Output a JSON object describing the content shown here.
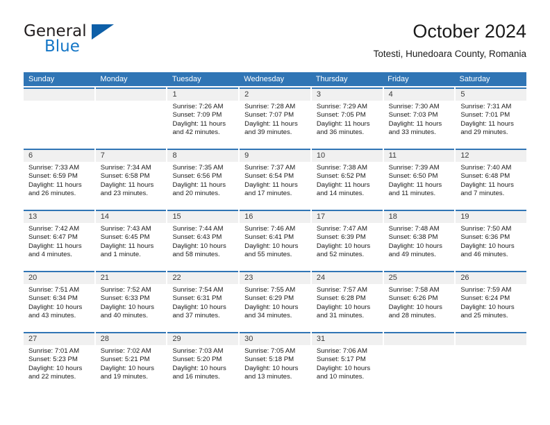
{
  "logo": {
    "word1": "General",
    "word2": "Blue",
    "triangle_color": "#0d5fa8",
    "blue_text_color": "#1476c6"
  },
  "header": {
    "title": "October 2024",
    "subtitle": "Totesti, Hunedoara County, Romania"
  },
  "theme": {
    "header_blue": "#3075b5",
    "date_strip_gray": "#f0f0f0"
  },
  "weekday_headers": [
    "Sunday",
    "Monday",
    "Tuesday",
    "Wednesday",
    "Thursday",
    "Friday",
    "Saturday"
  ],
  "weeks": [
    [
      {
        "day": "",
        "empty": true,
        "sunrise": "",
        "sunset": "",
        "daylight1": "",
        "daylight2": ""
      },
      {
        "day": "",
        "empty": true,
        "sunrise": "",
        "sunset": "",
        "daylight1": "",
        "daylight2": ""
      },
      {
        "day": "1",
        "sunrise": "Sunrise: 7:26 AM",
        "sunset": "Sunset: 7:09 PM",
        "daylight1": "Daylight: 11 hours",
        "daylight2": "and 42 minutes."
      },
      {
        "day": "2",
        "sunrise": "Sunrise: 7:28 AM",
        "sunset": "Sunset: 7:07 PM",
        "daylight1": "Daylight: 11 hours",
        "daylight2": "and 39 minutes."
      },
      {
        "day": "3",
        "sunrise": "Sunrise: 7:29 AM",
        "sunset": "Sunset: 7:05 PM",
        "daylight1": "Daylight: 11 hours",
        "daylight2": "and 36 minutes."
      },
      {
        "day": "4",
        "sunrise": "Sunrise: 7:30 AM",
        "sunset": "Sunset: 7:03 PM",
        "daylight1": "Daylight: 11 hours",
        "daylight2": "and 33 minutes."
      },
      {
        "day": "5",
        "sunrise": "Sunrise: 7:31 AM",
        "sunset": "Sunset: 7:01 PM",
        "daylight1": "Daylight: 11 hours",
        "daylight2": "and 29 minutes."
      }
    ],
    [
      {
        "day": "6",
        "sunrise": "Sunrise: 7:33 AM",
        "sunset": "Sunset: 6:59 PM",
        "daylight1": "Daylight: 11 hours",
        "daylight2": "and 26 minutes."
      },
      {
        "day": "7",
        "sunrise": "Sunrise: 7:34 AM",
        "sunset": "Sunset: 6:58 PM",
        "daylight1": "Daylight: 11 hours",
        "daylight2": "and 23 minutes."
      },
      {
        "day": "8",
        "sunrise": "Sunrise: 7:35 AM",
        "sunset": "Sunset: 6:56 PM",
        "daylight1": "Daylight: 11 hours",
        "daylight2": "and 20 minutes."
      },
      {
        "day": "9",
        "sunrise": "Sunrise: 7:37 AM",
        "sunset": "Sunset: 6:54 PM",
        "daylight1": "Daylight: 11 hours",
        "daylight2": "and 17 minutes."
      },
      {
        "day": "10",
        "sunrise": "Sunrise: 7:38 AM",
        "sunset": "Sunset: 6:52 PM",
        "daylight1": "Daylight: 11 hours",
        "daylight2": "and 14 minutes."
      },
      {
        "day": "11",
        "sunrise": "Sunrise: 7:39 AM",
        "sunset": "Sunset: 6:50 PM",
        "daylight1": "Daylight: 11 hours",
        "daylight2": "and 11 minutes."
      },
      {
        "day": "12",
        "sunrise": "Sunrise: 7:40 AM",
        "sunset": "Sunset: 6:48 PM",
        "daylight1": "Daylight: 11 hours",
        "daylight2": "and 7 minutes."
      }
    ],
    [
      {
        "day": "13",
        "sunrise": "Sunrise: 7:42 AM",
        "sunset": "Sunset: 6:47 PM",
        "daylight1": "Daylight: 11 hours",
        "daylight2": "and 4 minutes."
      },
      {
        "day": "14",
        "sunrise": "Sunrise: 7:43 AM",
        "sunset": "Sunset: 6:45 PM",
        "daylight1": "Daylight: 11 hours",
        "daylight2": "and 1 minute."
      },
      {
        "day": "15",
        "sunrise": "Sunrise: 7:44 AM",
        "sunset": "Sunset: 6:43 PM",
        "daylight1": "Daylight: 10 hours",
        "daylight2": "and 58 minutes."
      },
      {
        "day": "16",
        "sunrise": "Sunrise: 7:46 AM",
        "sunset": "Sunset: 6:41 PM",
        "daylight1": "Daylight: 10 hours",
        "daylight2": "and 55 minutes."
      },
      {
        "day": "17",
        "sunrise": "Sunrise: 7:47 AM",
        "sunset": "Sunset: 6:39 PM",
        "daylight1": "Daylight: 10 hours",
        "daylight2": "and 52 minutes."
      },
      {
        "day": "18",
        "sunrise": "Sunrise: 7:48 AM",
        "sunset": "Sunset: 6:38 PM",
        "daylight1": "Daylight: 10 hours",
        "daylight2": "and 49 minutes."
      },
      {
        "day": "19",
        "sunrise": "Sunrise: 7:50 AM",
        "sunset": "Sunset: 6:36 PM",
        "daylight1": "Daylight: 10 hours",
        "daylight2": "and 46 minutes."
      }
    ],
    [
      {
        "day": "20",
        "sunrise": "Sunrise: 7:51 AM",
        "sunset": "Sunset: 6:34 PM",
        "daylight1": "Daylight: 10 hours",
        "daylight2": "and 43 minutes."
      },
      {
        "day": "21",
        "sunrise": "Sunrise: 7:52 AM",
        "sunset": "Sunset: 6:33 PM",
        "daylight1": "Daylight: 10 hours",
        "daylight2": "and 40 minutes."
      },
      {
        "day": "22",
        "sunrise": "Sunrise: 7:54 AM",
        "sunset": "Sunset: 6:31 PM",
        "daylight1": "Daylight: 10 hours",
        "daylight2": "and 37 minutes."
      },
      {
        "day": "23",
        "sunrise": "Sunrise: 7:55 AM",
        "sunset": "Sunset: 6:29 PM",
        "daylight1": "Daylight: 10 hours",
        "daylight2": "and 34 minutes."
      },
      {
        "day": "24",
        "sunrise": "Sunrise: 7:57 AM",
        "sunset": "Sunset: 6:28 PM",
        "daylight1": "Daylight: 10 hours",
        "daylight2": "and 31 minutes."
      },
      {
        "day": "25",
        "sunrise": "Sunrise: 7:58 AM",
        "sunset": "Sunset: 6:26 PM",
        "daylight1": "Daylight: 10 hours",
        "daylight2": "and 28 minutes."
      },
      {
        "day": "26",
        "sunrise": "Sunrise: 7:59 AM",
        "sunset": "Sunset: 6:24 PM",
        "daylight1": "Daylight: 10 hours",
        "daylight2": "and 25 minutes."
      }
    ],
    [
      {
        "day": "27",
        "sunrise": "Sunrise: 7:01 AM",
        "sunset": "Sunset: 5:23 PM",
        "daylight1": "Daylight: 10 hours",
        "daylight2": "and 22 minutes."
      },
      {
        "day": "28",
        "sunrise": "Sunrise: 7:02 AM",
        "sunset": "Sunset: 5:21 PM",
        "daylight1": "Daylight: 10 hours",
        "daylight2": "and 19 minutes."
      },
      {
        "day": "29",
        "sunrise": "Sunrise: 7:03 AM",
        "sunset": "Sunset: 5:20 PM",
        "daylight1": "Daylight: 10 hours",
        "daylight2": "and 16 minutes."
      },
      {
        "day": "30",
        "sunrise": "Sunrise: 7:05 AM",
        "sunset": "Sunset: 5:18 PM",
        "daylight1": "Daylight: 10 hours",
        "daylight2": "and 13 minutes."
      },
      {
        "day": "31",
        "sunrise": "Sunrise: 7:06 AM",
        "sunset": "Sunset: 5:17 PM",
        "daylight1": "Daylight: 10 hours",
        "daylight2": "and 10 minutes."
      },
      {
        "day": "",
        "empty": true,
        "sunrise": "",
        "sunset": "",
        "daylight1": "",
        "daylight2": ""
      },
      {
        "day": "",
        "empty": true,
        "sunrise": "",
        "sunset": "",
        "daylight1": "",
        "daylight2": ""
      }
    ]
  ]
}
